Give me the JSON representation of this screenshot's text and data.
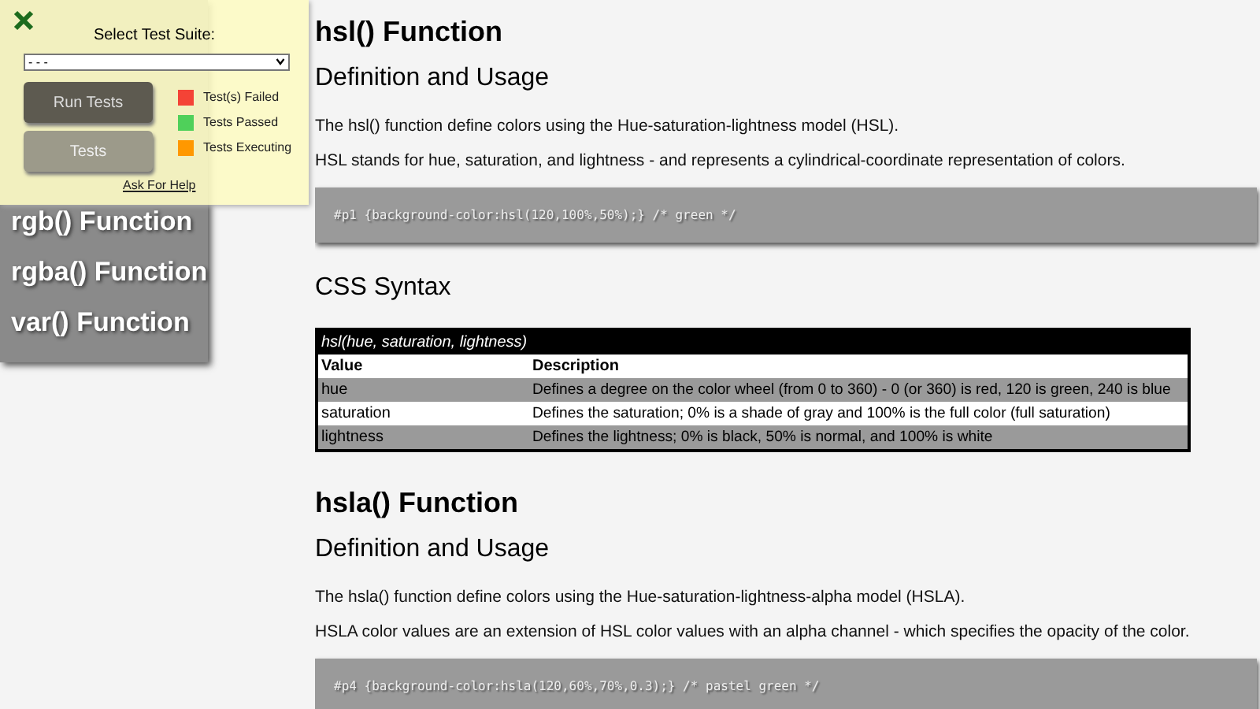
{
  "test_panel": {
    "suite_label": "Select Test Suite:",
    "suite_value": "- - -",
    "run_button": "Run Tests",
    "tests_button": "Tests",
    "legend": [
      {
        "label": "Test(s) Failed",
        "color": "#f44336"
      },
      {
        "label": "Tests Passed",
        "color": "#4fd05a"
      },
      {
        "label": "Tests Executing",
        "color": "#ff9800"
      }
    ],
    "help_link": "Ask For Help"
  },
  "sidebar": {
    "items": [
      "rgb() Function",
      "rgba() Function",
      "var() Function"
    ]
  },
  "sections": [
    {
      "heading": "hsl() Function",
      "subheading": "Definition and Usage",
      "paragraphs": [
        "The hsl() function define colors using the Hue-saturation-lightness model (HSL).",
        "HSL stands for hue, saturation, and lightness - and represents a cylindrical-coordinate representation of colors."
      ],
      "code": "#p1 {background-color:hsl(120,100%,50%);} /* green */",
      "syntax_heading": "CSS Syntax",
      "table": {
        "caption": "hsl(hue, saturation, lightness)",
        "columns": [
          "Value",
          "Description"
        ],
        "rows": [
          [
            "hue",
            "Defines a degree on the color wheel (from 0 to 360) - 0 (or 360) is red, 120 is green, 240 is blue"
          ],
          [
            "saturation",
            "Defines the saturation; 0% is a shade of gray and 100% is the full color (full saturation)"
          ],
          [
            "lightness",
            "Defines the lightness; 0% is black, 50% is normal, and 100% is white"
          ]
        ]
      }
    },
    {
      "heading": "hsla() Function",
      "subheading": "Definition and Usage",
      "paragraphs": [
        "The hsla() function define colors using the Hue-saturation-lightness-alpha model (HSLA).",
        "HSLA color values are an extension of HSL color values with an alpha channel - which specifies the opacity of the color."
      ],
      "code": "#p4 {background-color:hsla(120,60%,70%,0.3);} /* pastel green */"
    }
  ]
}
